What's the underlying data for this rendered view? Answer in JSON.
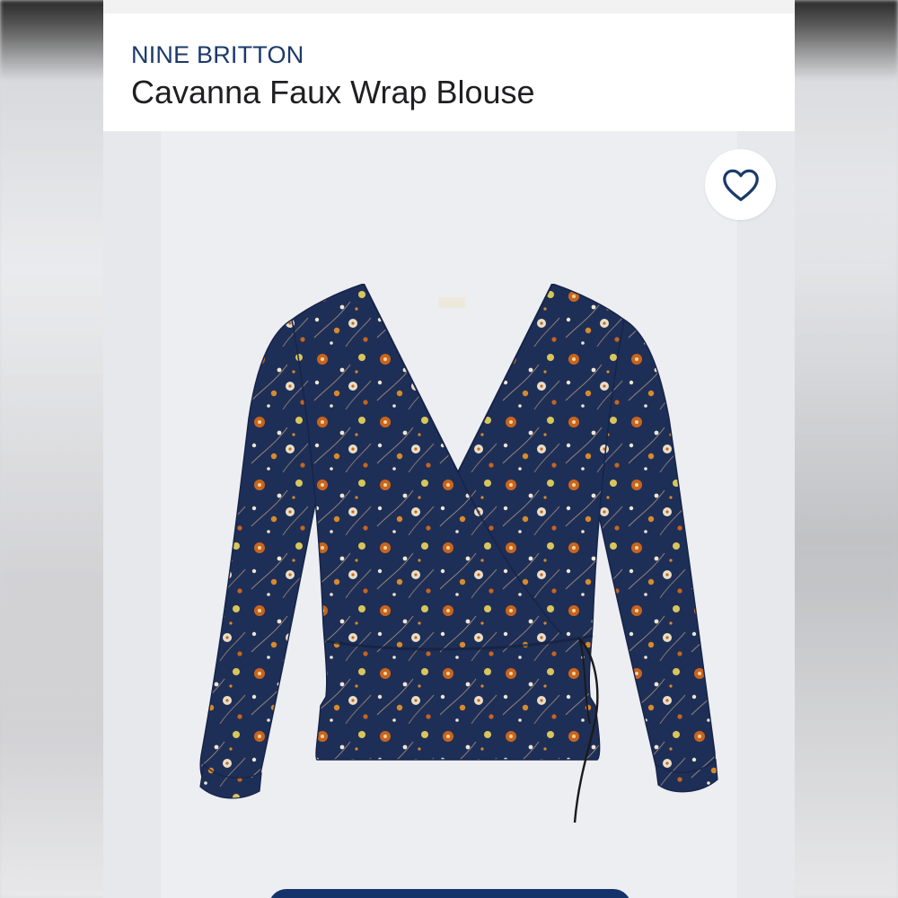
{
  "product": {
    "brand": "NINE BRITTON",
    "name": "Cavanna Faux Wrap Blouse"
  },
  "icons": {
    "favorite": "heart-outline-icon"
  },
  "colors": {
    "brand_text": "#1b3a6b",
    "title_text": "#1f1f22",
    "image_bg": "#eceef1",
    "blouse_base": "#1e2f57",
    "cta": "#14336b"
  }
}
